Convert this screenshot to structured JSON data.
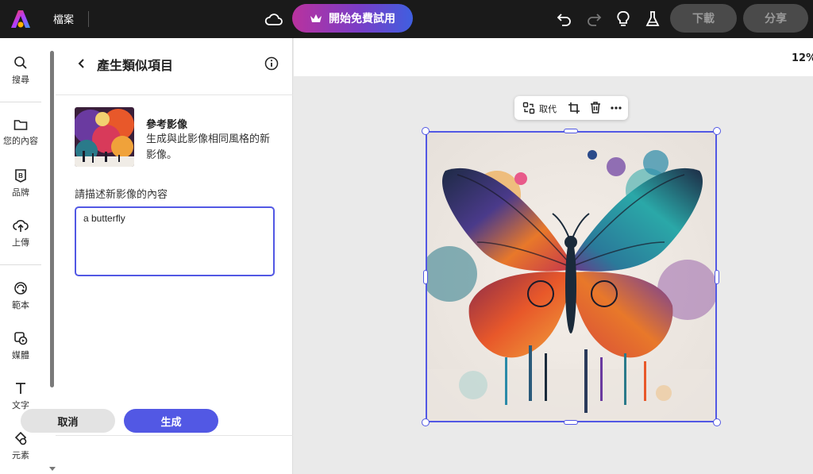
{
  "topbar": {
    "file_menu": "檔案",
    "trial_button": "開始免費試用",
    "download_button": "下載",
    "share_button": "分享"
  },
  "rail": {
    "items": [
      {
        "label": "搜尋",
        "icon": "search-icon"
      },
      {
        "label": "您的內容",
        "icon": "folder-icon"
      },
      {
        "label": "品牌",
        "icon": "brand-icon"
      },
      {
        "label": "上傳",
        "icon": "upload-icon"
      },
      {
        "label": "範本",
        "icon": "template-icon"
      },
      {
        "label": "媒體",
        "icon": "media-icon"
      },
      {
        "label": "文字",
        "icon": "text-icon"
      },
      {
        "label": "元素",
        "icon": "elements-icon"
      }
    ]
  },
  "panel": {
    "title": "產生類似項目",
    "ref_title": "參考影像",
    "ref_desc": "生成與此影像相同風格的新影像。",
    "prompt_label": "請描述新影像的內容",
    "prompt_value": "a butterfly",
    "cancel_button": "取消",
    "generate_button": "生成"
  },
  "canvas": {
    "zoom": "12%",
    "toolbar_replace": "取代"
  },
  "colors": {
    "accent": "#5258e4",
    "topbar_bg": "#1a1a1a"
  }
}
